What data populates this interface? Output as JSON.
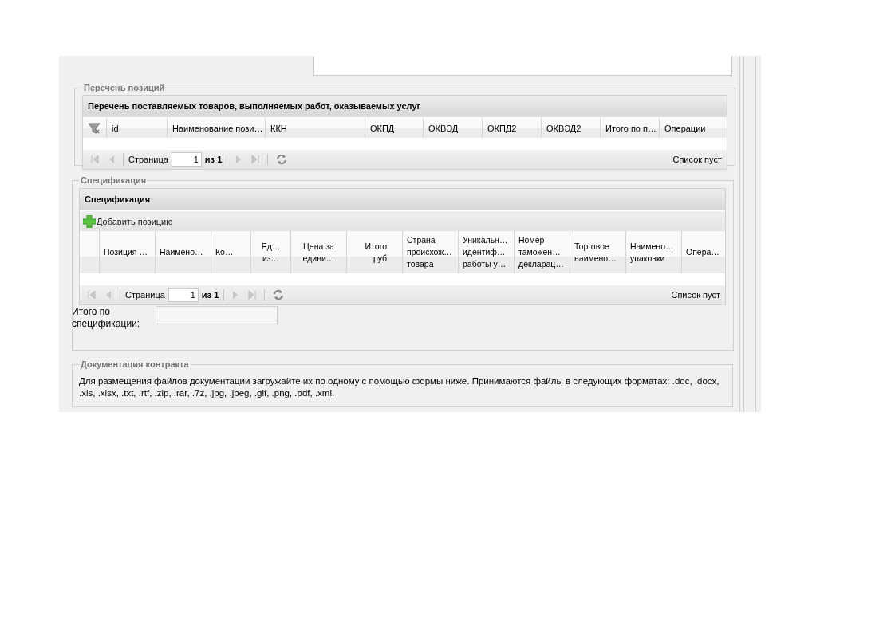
{
  "positions": {
    "legend": "Перечень позиций",
    "grid_title": "Перечень поставляемых товаров, выполняемых работ, оказываемых услуг",
    "columns": [
      {
        "kind": "icon",
        "text": ""
      },
      {
        "kind": "text",
        "text": "id"
      },
      {
        "kind": "text",
        "text": "Наименование пози…"
      },
      {
        "kind": "text",
        "text": "ККН"
      },
      {
        "kind": "text",
        "text": "ОКПД"
      },
      {
        "kind": "text",
        "text": "ОКВЭД"
      },
      {
        "kind": "text",
        "text": "ОКПД2"
      },
      {
        "kind": "text",
        "text": "ОКВЭД2"
      },
      {
        "kind": "text",
        "text": "Итого по п…"
      },
      {
        "kind": "text",
        "text": "Операции"
      }
    ],
    "pager": {
      "page_label": "Страница",
      "page": "1",
      "of": "из 1",
      "status": "Список пуст"
    }
  },
  "specification": {
    "legend": "Спецификация",
    "grid_title": "Спецификация",
    "add_button": "Добавить позицию",
    "columns": [
      {
        "text": ""
      },
      {
        "text": "Позиция …"
      },
      {
        "text": "Наимено…"
      },
      {
        "text": "Ко…"
      },
      {
        "text": "Ед…\nиз…"
      },
      {
        "text": "Цена за\nедини…"
      },
      {
        "text": "Итого,\nруб."
      },
      {
        "text": "Страна\nпроисхож…\nтовара"
      },
      {
        "text": "Уникальн…\nидентиф…\nработы у…"
      },
      {
        "text": "Номер\nтаможен…\nдекларац…"
      },
      {
        "text": "Торговое\nнаимено…"
      },
      {
        "text": "Наимено…\nупаковки"
      },
      {
        "text": "Опера…"
      }
    ],
    "pager": {
      "page_label": "Страница",
      "page": "1",
      "of": "из 1",
      "status": "Список пуст"
    },
    "total_label": "Итого по\nспецификации:"
  },
  "documentation": {
    "legend": "Документация контракта",
    "text": "Для размещения файлов документации загружайте их по одному с помощью формы ниже. Принимаются файлы в следующих форматах: .doc, .docx, .xls, .xlsx, .txt, .rtf, .zip, .rar, .7z, .jpg, .jpeg, .gif, .png, .pdf, .xml."
  }
}
